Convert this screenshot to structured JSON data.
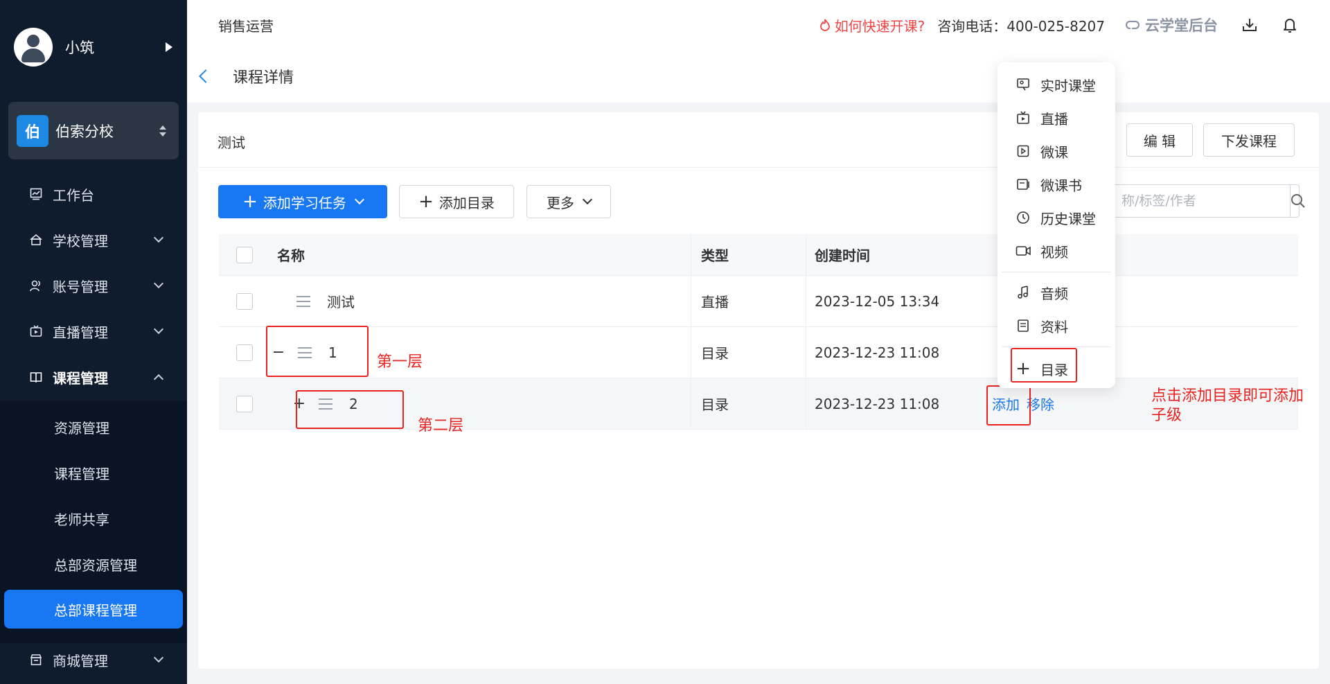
{
  "sidebar": {
    "user_name": "小筑",
    "school": {
      "badge": "伯",
      "name": "伯索分校"
    },
    "menu": [
      {
        "label": "工作台",
        "icon": "chart-icon"
      },
      {
        "label": "学校管理",
        "icon": "school-icon"
      },
      {
        "label": "账号管理",
        "icon": "users-icon"
      },
      {
        "label": "直播管理",
        "icon": "live-icon"
      },
      {
        "label": "课程管理",
        "icon": "book-icon"
      },
      {
        "label": "商城管理",
        "icon": "store-icon"
      }
    ],
    "submenu": [
      "资源管理",
      "课程管理",
      "老师共享",
      "总部资源管理",
      "总部课程管理"
    ]
  },
  "topbar": {
    "title": "销售运营",
    "help_link": "如何快速开课?",
    "phone": "咨询电话：400-025-8207",
    "brand": "云学堂后台"
  },
  "breadcrumb": {
    "title": "课程详情"
  },
  "card": {
    "title": "测试",
    "edit_btn": "编 辑",
    "publish_btn": "下发课程",
    "add_task_btn": "添加学习任务",
    "add_dir_btn": "添加目录",
    "more_btn": "更多",
    "search_placeholder": "称/标签/作者"
  },
  "table": {
    "headers": {
      "name": "名称",
      "type": "类型",
      "time": "创建时间"
    },
    "rows": [
      {
        "name": "测试",
        "type": "直播",
        "time": "2023-12-05 13:34",
        "expander": ""
      },
      {
        "name": "1",
        "type": "目录",
        "time": "2023-12-23 11:08",
        "expander": "−"
      },
      {
        "name": "2",
        "type": "目录",
        "time": "2023-12-23 11:08",
        "expander": "+",
        "actions": [
          "添加",
          "移除"
        ]
      }
    ]
  },
  "dropdown": {
    "items": [
      "实时课堂",
      "直播",
      "微课",
      "微课书",
      "历史课堂",
      "视频",
      "音频",
      "资料"
    ],
    "add_dir": "目录"
  },
  "annotations": {
    "layer1": "第一层",
    "layer2": "第二层",
    "hint": "点击添加目录即可添加子级"
  },
  "colors": {
    "primary": "#1877f2",
    "sidebar": "#0f1c2e",
    "annotation": "#e8231f"
  }
}
